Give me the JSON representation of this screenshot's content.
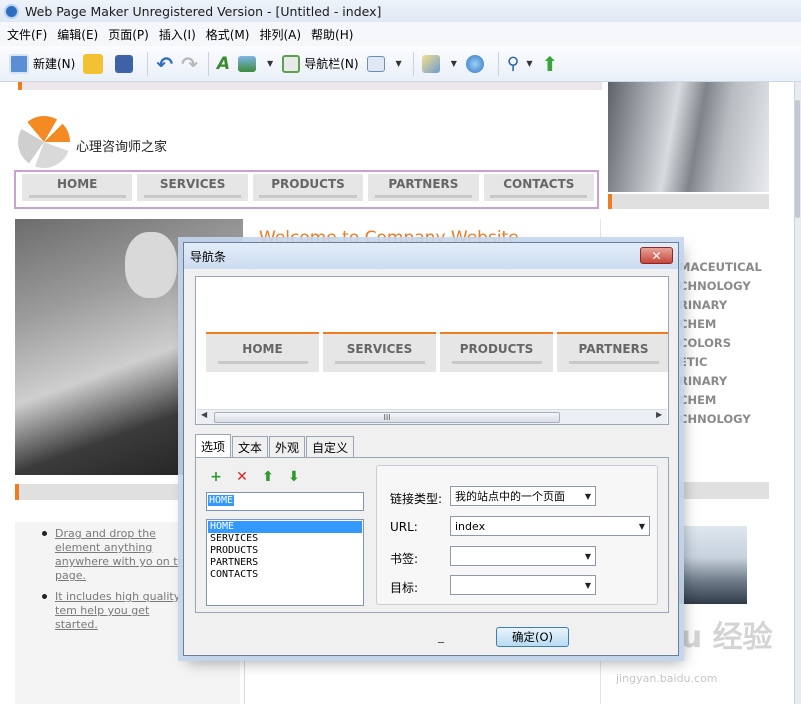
{
  "window": {
    "title": "Web Page Maker Unregistered Version - [Untitled - index]"
  },
  "menu": [
    "文件(F)",
    "编辑(E)",
    "页面(P)",
    "插入(I)",
    "格式(M)",
    "排列(A)",
    "帮助(H)"
  ],
  "toolbar": {
    "new_label": "新建(N)",
    "navbar_label": "导航栏(N)"
  },
  "site": {
    "logo_text": "心理咨询师之家",
    "nav": [
      "HOME",
      "SERVICES",
      "PRODUCTS",
      "PARTNERS",
      "CONTACTS"
    ],
    "welcome": "Welcome to Company Website",
    "right_list": [
      "MACEUTICAL",
      "CHNOLOGY",
      "RINARY",
      "CHEM",
      "COLORS",
      "ETIC",
      "RINARY",
      "CHEM",
      "CHNOLOGY"
    ],
    "bullets": [
      "Drag and drop the element anything anywhere with yo on the page.",
      "It includes high quality tem help you get started."
    ]
  },
  "watermark": {
    "main": "Baidu 经验",
    "sub": "jingyan.baidu.com"
  },
  "dialog": {
    "title": "导航条",
    "close": "✕",
    "preview_nav": [
      "HOME",
      "SERVICES",
      "PRODUCTS",
      "PARTNERS"
    ],
    "scroll_grip": "III",
    "tabs": [
      "选项",
      "文本",
      "外观",
      "自定义"
    ],
    "name_value": "HOME",
    "items": [
      "HOME",
      "SERVICES",
      "PRODUCTS",
      "PARTNERS",
      "CONTACTS"
    ],
    "link_type_label": "链接类型:",
    "link_type_value": "我的站点中的一个页面",
    "url_label": "URL:",
    "url_value": "index",
    "bookmark_label": "书签:",
    "bookmark_value": "",
    "target_label": "目标:",
    "target_value": "",
    "ok_label": "确定(O)",
    "dash": "_"
  }
}
